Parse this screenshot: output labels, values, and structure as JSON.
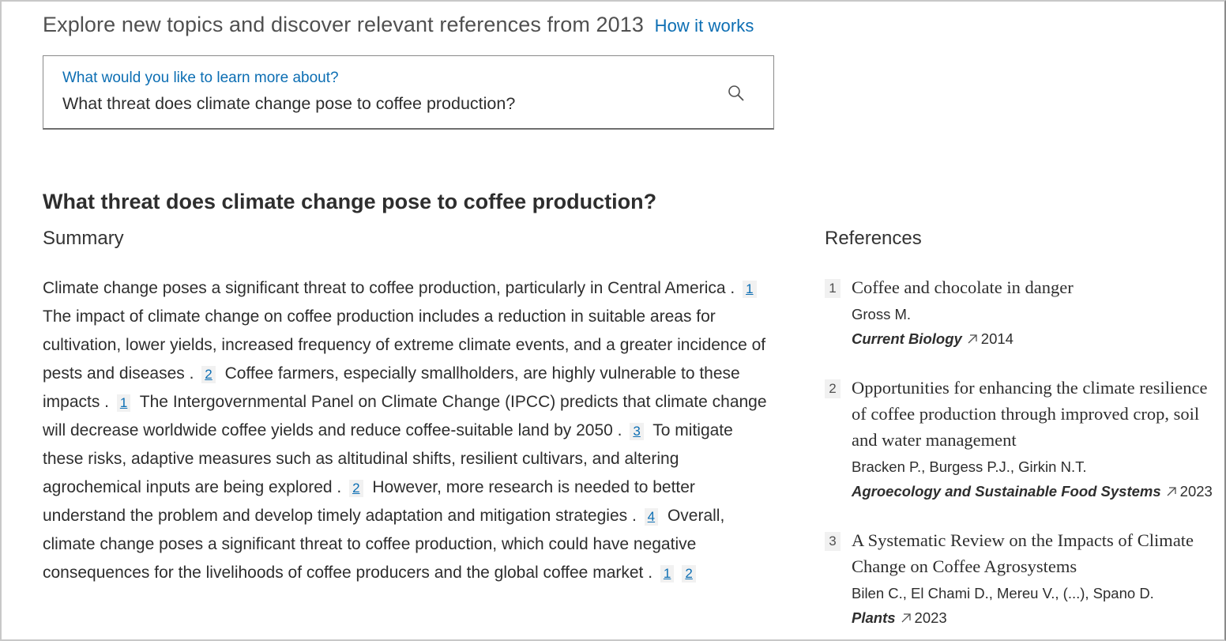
{
  "header": {
    "title": "Explore new topics and discover relevant references from 2013",
    "how_it_works": "How it works"
  },
  "search": {
    "label": "What would you like to learn more about?",
    "value": "What threat does climate change pose to coffee production?",
    "icon": "search-icon"
  },
  "question": "What threat does climate change pose to coffee production?",
  "summary": {
    "heading": "Summary",
    "segments": [
      {
        "text": "Climate change poses a significant threat to coffee production, particularly in Central America .",
        "cites": [
          "1"
        ]
      },
      {
        "text": "The impact of climate change on coffee production includes a reduction in suitable areas for cultivation, lower yields, increased frequency of extreme climate events, and a greater incidence of pests and diseases .",
        "cites": [
          "2"
        ]
      },
      {
        "text": "Coffee farmers, especially smallholders, are highly vulnerable to these impacts .",
        "cites": [
          "1"
        ]
      },
      {
        "text": "The Intergovernmental Panel on Climate Change (IPCC) predicts that climate change will decrease worldwide coffee yields and reduce coffee-suitable land by 2050 .",
        "cites": [
          "3"
        ]
      },
      {
        "text": "To mitigate these risks, adaptive measures such as altitudinal shifts, resilient cultivars, and altering agrochemical inputs are being explored .",
        "cites": [
          "2"
        ]
      },
      {
        "text": "However, more research is needed to better understand the problem and develop timely adaptation and mitigation strategies .",
        "cites": [
          "4"
        ]
      },
      {
        "text": "Overall, climate change poses a significant threat to coffee production, which could have negative consequences for the livelihoods of coffee producers and the global coffee market .",
        "cites": [
          "1",
          "2"
        ]
      }
    ]
  },
  "references": {
    "heading": "References",
    "items": [
      {
        "num": "1",
        "title": "Coffee and chocolate in danger",
        "authors": "Gross M.",
        "journal": "Current Biology",
        "year": "2014"
      },
      {
        "num": "2",
        "title": "Opportunities for enhancing the climate resilience of coffee production through improved crop, soil and water management",
        "authors": "Bracken P., Burgess P.J., Girkin N.T.",
        "journal": "Agroecology and Sustainable Food Systems",
        "year": "2023"
      },
      {
        "num": "3",
        "title": "A Systematic Review on the Impacts of Climate Change on Coffee Agrosystems",
        "authors": "Bilen C., El Chami D., Mereu V., (...), Spano D.",
        "journal": "Plants",
        "year": "2023"
      }
    ]
  },
  "colors": {
    "link": "#0c6eb3",
    "text": "#2e2e2e",
    "cite_bg": "#f1f1f1"
  }
}
